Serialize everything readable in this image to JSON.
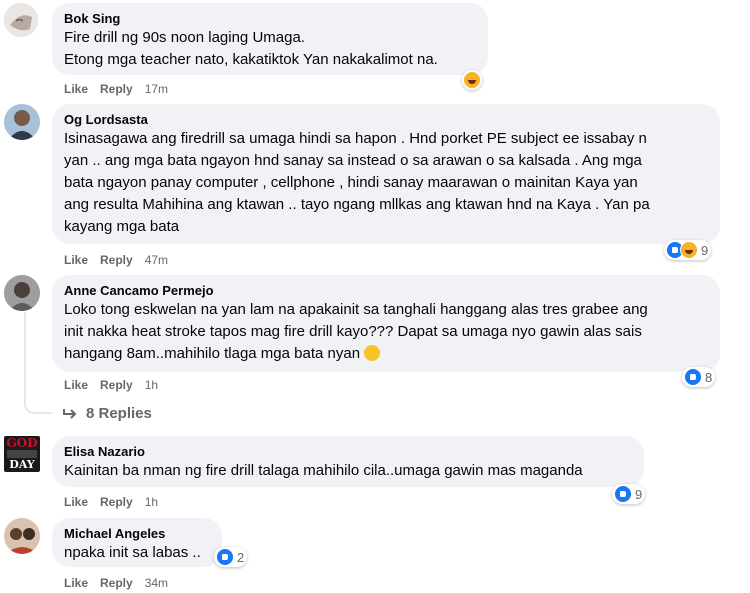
{
  "comments": [
    {
      "author": "Bok Sing",
      "lines": [
        "Fire drill ng 90s noon laging Umaga.",
        "Etong mga teacher nato, kakatiktok Yan nakakalimot na."
      ],
      "like": "Like",
      "reply": "Reply",
      "time": "17m"
    },
    {
      "author": "Og Lordsasta",
      "lines": [
        "Isinasagawa ang firedrill sa umaga hindi sa hapon . Hnd porket PE subject ee issabay n",
        "yan .. ang mga bata ngayon hnd sanay sa instead o sa arawan o sa kalsada . Ang mga",
        "bata ngayon panay computer , cellphone , hindi sanay maarawan o mainitan Kaya yan",
        "ang resulta Mahihina ang ktawan .. tayo ngang mllkas ang ktawan hnd na Kaya . Yan pa",
        "kayang mga bata"
      ],
      "like": "Like",
      "reply": "Reply",
      "time": "47m",
      "reactions": "9"
    },
    {
      "author": "Anne Cancamo Permejo",
      "lines": [
        "Loko tong eskwelan na yan lam na apakainit sa tanghali hanggang alas tres grabee ang",
        "init nakka heat stroke tapos mag fire drill kayo??? Dapat sa umaga nyo gawin alas sais",
        "hangang 8am..mahihilo tlaga mga bata nyan"
      ],
      "like": "Like",
      "reply": "Reply",
      "time": "1h",
      "reactions": "8",
      "replies": "8 Replies"
    },
    {
      "author": "Elisa Nazario",
      "lines": [
        "Kainitan ba nman ng fire drill talaga mahihilo cila..umaga gawin mas maganda"
      ],
      "like": "Like",
      "reply": "Reply",
      "time": "1h",
      "reactions": "9"
    },
    {
      "author": "Michael Angeles",
      "lines": [
        "npaka init sa labas .."
      ],
      "like": "Like",
      "reply": "Reply",
      "time": "34m",
      "reactions": "2"
    }
  ],
  "avatar_text": [
    "GOD",
    "DAY"
  ],
  "colors": {
    "bubble": "#f0f2f5",
    "meta": "#65676b",
    "like_blue": "#1877f2",
    "haha": "#f7b125"
  }
}
